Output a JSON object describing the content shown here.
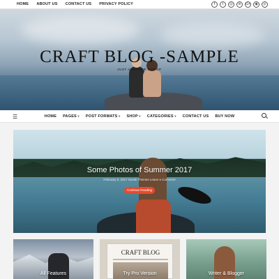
{
  "top_nav": {
    "items": [
      "HOME",
      "ABOUT US",
      "CONTACT US",
      "PRIVACY POLICY"
    ]
  },
  "social_icons": [
    {
      "name": "facebook-icon",
      "glyph": "f"
    },
    {
      "name": "twitter-icon",
      "glyph": "t"
    },
    {
      "name": "instagram-icon",
      "glyph": "◎"
    },
    {
      "name": "linkedin-icon",
      "glyph": "in"
    },
    {
      "name": "google-plus-icon",
      "glyph": "G+"
    },
    {
      "name": "tumblr-icon",
      "glyph": "◉"
    },
    {
      "name": "pinterest-icon",
      "glyph": "p"
    }
  ],
  "hero": {
    "title": "CRAFT BLOG -SAMPLE",
    "tagline": "JUST ANOTHER WORDP"
  },
  "main_nav": {
    "items": [
      {
        "label": "HOME",
        "dropdown": false
      },
      {
        "label": "PAGES",
        "dropdown": true
      },
      {
        "label": "POST FORMATS",
        "dropdown": true
      },
      {
        "label": "SHOP",
        "dropdown": true
      },
      {
        "label": "CATEGORIES",
        "dropdown": true
      },
      {
        "label": "CONTACT US",
        "dropdown": false
      },
      {
        "label": "BUY NOW",
        "dropdown": false
      }
    ]
  },
  "featured_post": {
    "title": "Some Photos of Summer 2017",
    "meta": "February 5, 2017  Suvile Themes  Leave a Comment",
    "button_label": "Continue Reading",
    "accent_color": "#e64a2e"
  },
  "cards": [
    {
      "label": "All Features"
    },
    {
      "label": "Try Pro Version",
      "mock_title": "CRAFT BLOG"
    },
    {
      "label": "Writer & Blogger"
    }
  ]
}
